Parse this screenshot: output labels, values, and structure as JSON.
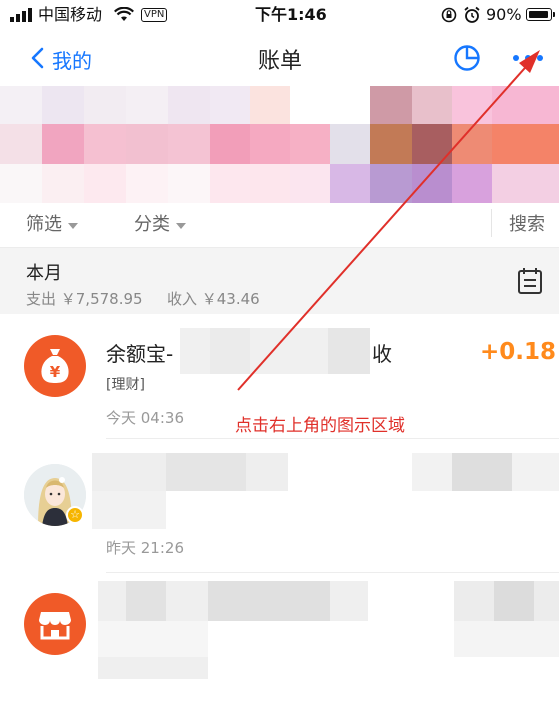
{
  "status_bar": {
    "carrier": "中国移动",
    "vpn": "VPN",
    "time": "下午1:46",
    "battery": "90%"
  },
  "nav": {
    "back_label": "我的",
    "title": "账单"
  },
  "filters": {
    "filter_label": "筛选",
    "category_label": "分类",
    "search_label": "搜索"
  },
  "month": {
    "title": "本月",
    "expense": "支出 ￥7,578.95",
    "income": "收入 ￥43.46"
  },
  "transactions": [
    {
      "title": "余额宝-",
      "title_tail": "收",
      "tag": "[理财]",
      "time": "今天  04:36",
      "amount": "+0.18",
      "icon": "money-bag-icon"
    },
    {
      "title": "",
      "tag": "",
      "time": "昨天  21:26",
      "amount": "",
      "icon": "user-avatar"
    },
    {
      "title": "",
      "tag": "",
      "time": "",
      "amount": "",
      "icon": "store-icon"
    }
  ],
  "annotation": {
    "text": "点击右上角的图示区域"
  },
  "colors": {
    "accent_blue": "#1677ff",
    "orange": "#f05a28",
    "amount_orange": "#ff8a1c",
    "annotation_red": "#e0302a"
  }
}
